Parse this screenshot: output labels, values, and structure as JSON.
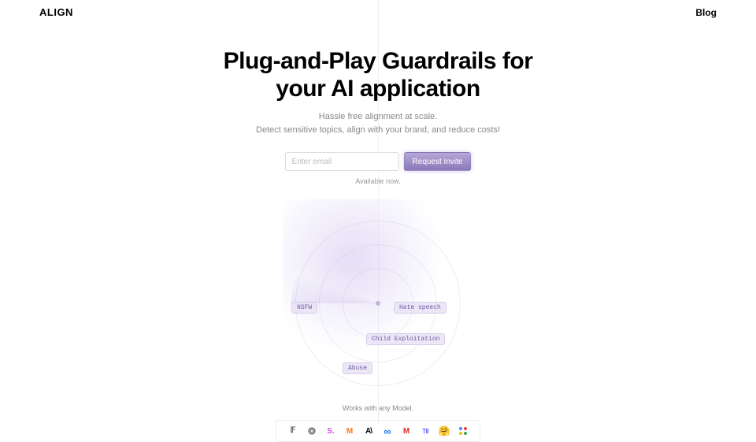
{
  "header": {
    "logo": "ALIGN",
    "nav": {
      "blog": "Blog"
    }
  },
  "hero": {
    "headline_line1": "Plug-and-Play Guardrails for",
    "headline_line2": "your AI application",
    "sub_line1": "Hassle free alignment at scale.",
    "sub_line2": "Detect sensitive topics, align with your brand, and reduce costs!",
    "email_placeholder": "Enter email",
    "cta": "Request Invite",
    "availability": "Available now."
  },
  "radar": {
    "tags": {
      "nsfw": "NSFW",
      "hate": "Hate speech",
      "child": "Child Exploitation",
      "abuse": "Abuse"
    }
  },
  "models": {
    "caption": "Works with any Model.",
    "items": [
      "falcon",
      "openai",
      "stability",
      "mistral",
      "anthropic",
      "meta",
      "mm",
      "tii",
      "huggingface",
      "google"
    ]
  }
}
